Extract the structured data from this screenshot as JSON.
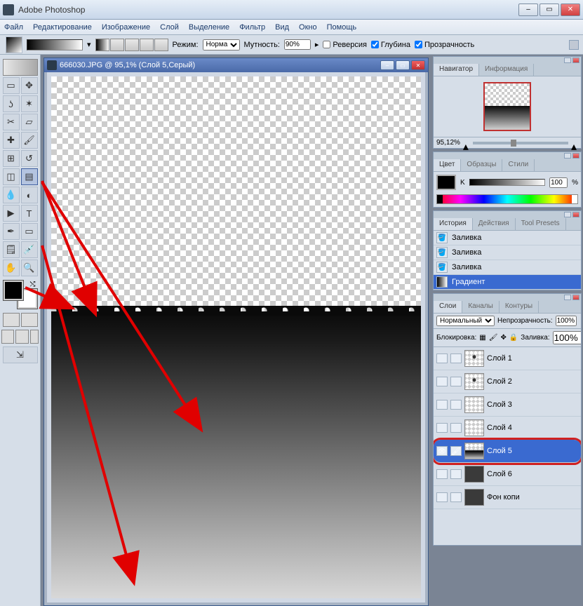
{
  "app": {
    "title": "Adobe Photoshop"
  },
  "win_controls": {
    "min": "–",
    "max": "▭",
    "close": "✕"
  },
  "menu": [
    "Файл",
    "Редактирование",
    "Изображение",
    "Слой",
    "Выделение",
    "Фильтр",
    "Вид",
    "Окно",
    "Помощь"
  ],
  "options": {
    "mode_label": "Режим:",
    "mode_value": "Норма",
    "opacity_label": "Мутность:",
    "opacity_value": "90%",
    "chk_reverse": "Реверсия",
    "chk_depth": "Глубина",
    "chk_trans": "Прозрачность"
  },
  "doc": {
    "title": "666030.JPG @ 95,1% (Слой 5,Серый)"
  },
  "navigator": {
    "tab_nav": "Навигатор",
    "tab_info": "Информация",
    "zoom": "95,12%"
  },
  "color": {
    "tab_color": "Цвет",
    "tab_swatch": "Образцы",
    "tab_styles": "Стили",
    "channel": "K",
    "value": "100",
    "pct": "%"
  },
  "history": {
    "tab_hist": "История",
    "tab_actions": "Действия",
    "tab_presets": "Tool Presets",
    "items": [
      {
        "label": "Заливка"
      },
      {
        "label": "Заливка"
      },
      {
        "label": "Заливка"
      },
      {
        "label": "Градиент"
      }
    ]
  },
  "layers": {
    "tab_layers": "Слои",
    "tab_channels": "Каналы",
    "tab_paths": "Контуры",
    "blend_label": "Нормальный",
    "opacity_label": "Непрозрачность:",
    "opacity_value": "100%",
    "lock_label": "Блокировка:",
    "fill_label": "Заливка:",
    "fill_value": "100%",
    "items": [
      {
        "name": "Слой 1",
        "thumb": "img"
      },
      {
        "name": "Слой 2",
        "thumb": "img"
      },
      {
        "name": "Слой 3",
        "thumb": "checker"
      },
      {
        "name": "Слой 4",
        "thumb": "checker"
      },
      {
        "name": "Слой 5",
        "thumb": "grad",
        "selected": true
      },
      {
        "name": "Слой 6",
        "thumb": "dark"
      },
      {
        "name": "Фон копи",
        "thumb": "dark"
      }
    ]
  }
}
